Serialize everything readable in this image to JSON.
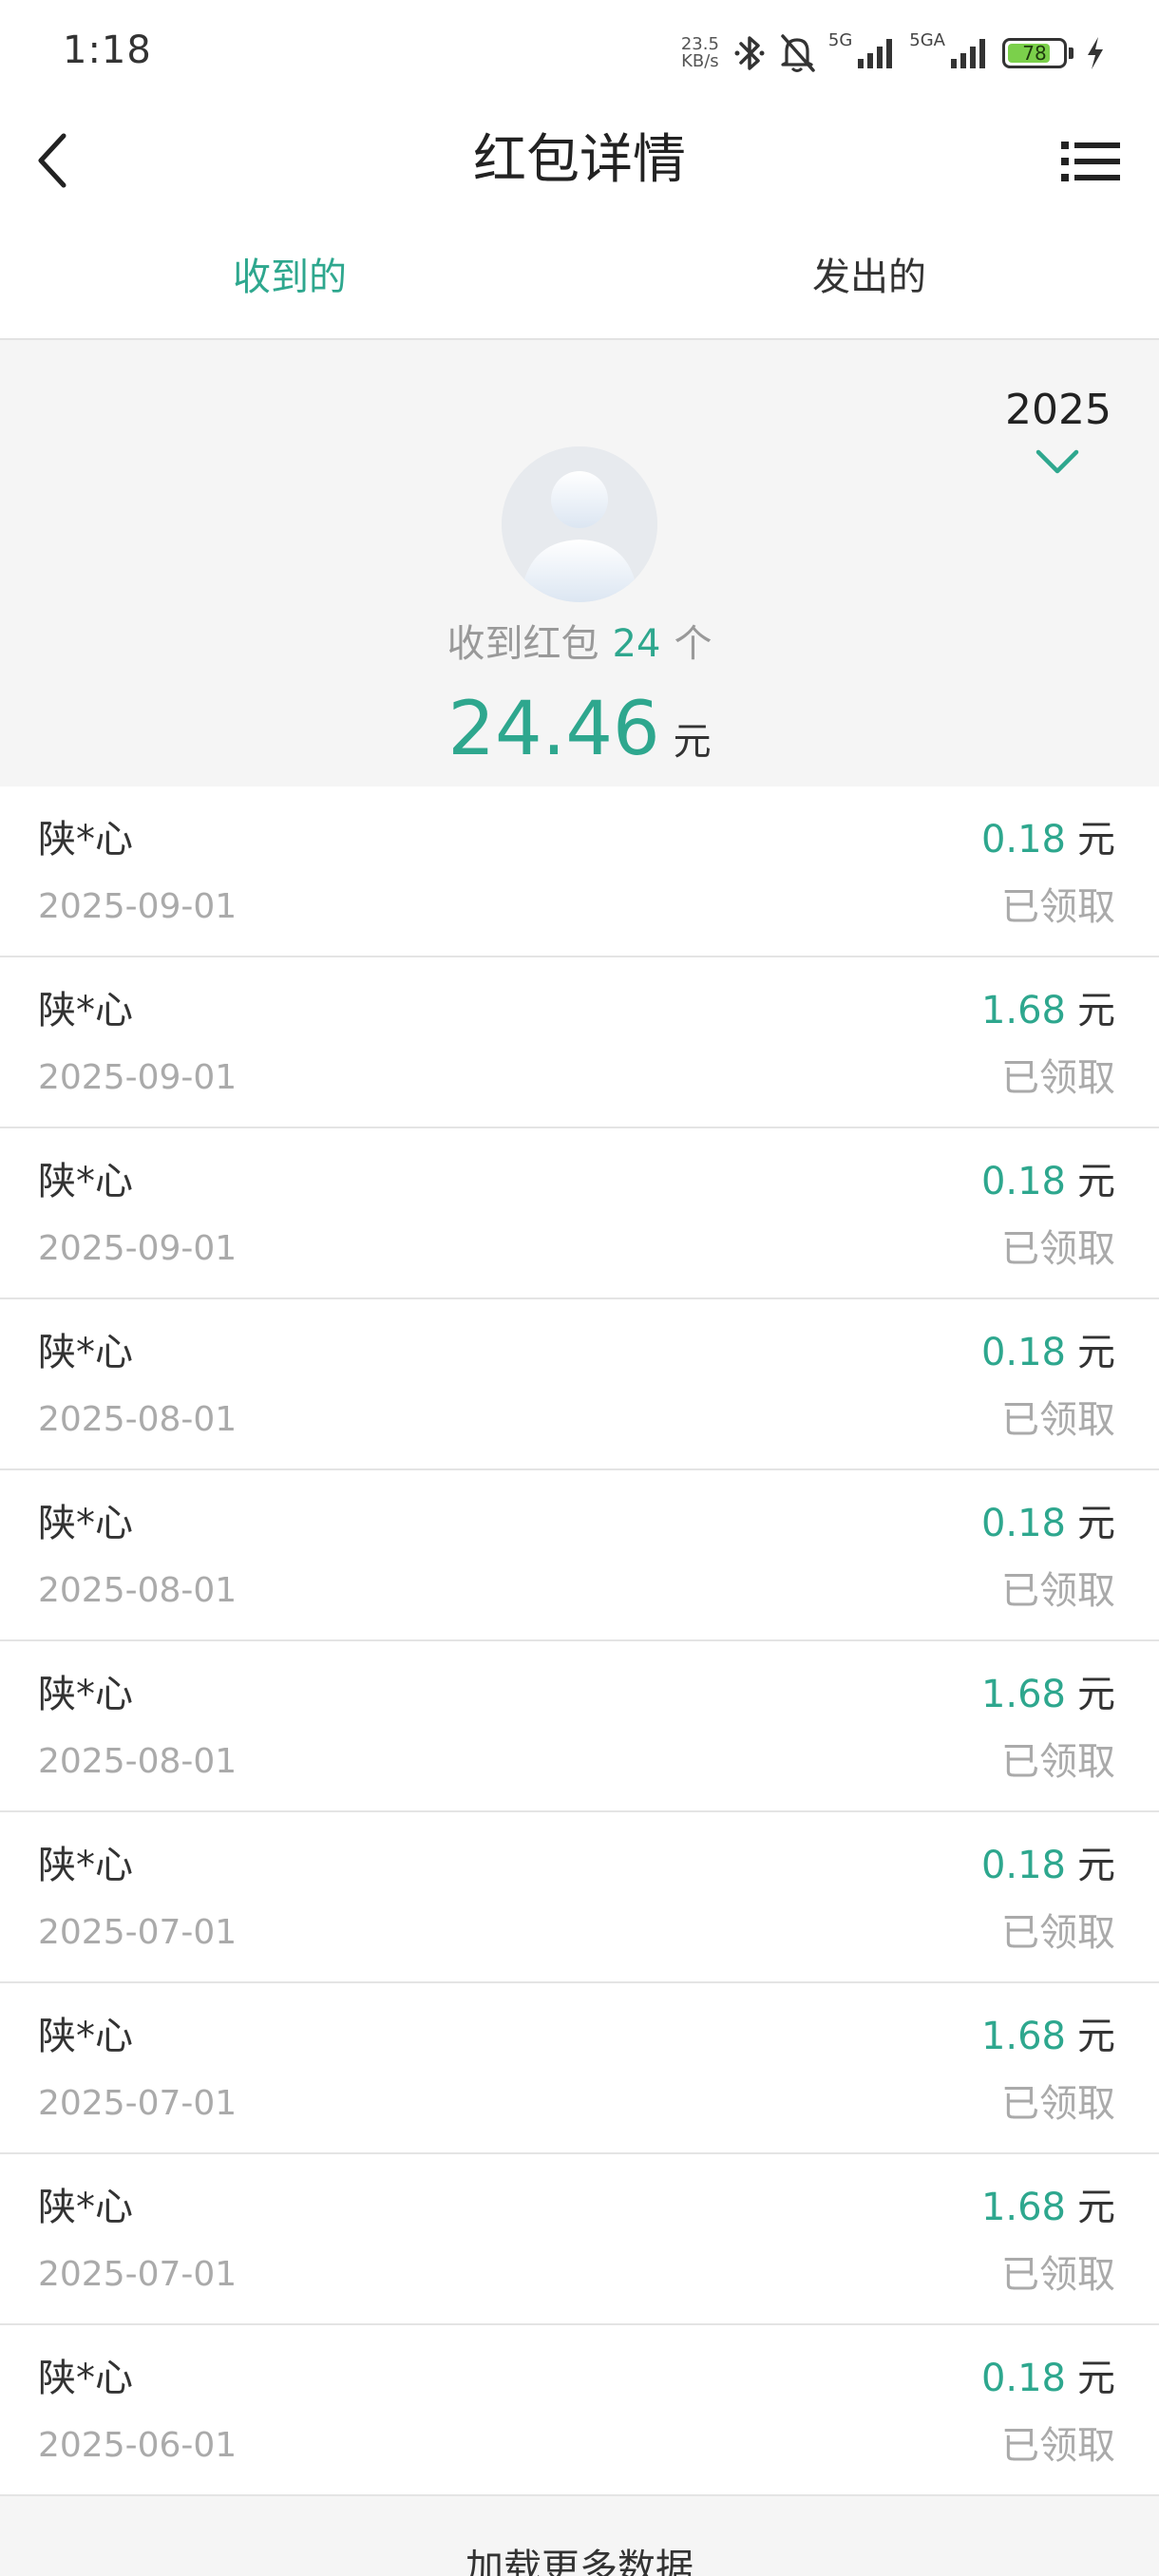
{
  "status_bar": {
    "time": "1:18",
    "net_speed_value": "23.5",
    "net_speed_unit": "KB/s",
    "sim1_label": "5G",
    "sim2_label": "5GA",
    "battery_level": "78",
    "battery_fraction": 0.78,
    "battery_color": "#7bd04b",
    "icons": [
      "bluetooth-icon",
      "mute-bell-icon",
      "signal-icon",
      "battery-icon",
      "charging-icon"
    ]
  },
  "nav": {
    "title": "红包详情",
    "back_icon": "chevron-left-icon",
    "menu_icon": "list-menu-icon"
  },
  "tabs": [
    {
      "label": "收到的",
      "active": true
    },
    {
      "label": "发出的",
      "active": false
    }
  ],
  "summary": {
    "year": "2025",
    "count_prefix": "收到红包",
    "count": "24",
    "count_suffix": "个",
    "total": "24.46",
    "unit": "元"
  },
  "records": [
    {
      "name": "陕*心",
      "date": "2025-09-01",
      "amount": "0.18",
      "unit": "元",
      "status": "已领取"
    },
    {
      "name": "陕*心",
      "date": "2025-09-01",
      "amount": "1.68",
      "unit": "元",
      "status": "已领取"
    },
    {
      "name": "陕*心",
      "date": "2025-09-01",
      "amount": "0.18",
      "unit": "元",
      "status": "已领取"
    },
    {
      "name": "陕*心",
      "date": "2025-08-01",
      "amount": "0.18",
      "unit": "元",
      "status": "已领取"
    },
    {
      "name": "陕*心",
      "date": "2025-08-01",
      "amount": "0.18",
      "unit": "元",
      "status": "已领取"
    },
    {
      "name": "陕*心",
      "date": "2025-08-01",
      "amount": "1.68",
      "unit": "元",
      "status": "已领取"
    },
    {
      "name": "陕*心",
      "date": "2025-07-01",
      "amount": "0.18",
      "unit": "元",
      "status": "已领取"
    },
    {
      "name": "陕*心",
      "date": "2025-07-01",
      "amount": "1.68",
      "unit": "元",
      "status": "已领取"
    },
    {
      "name": "陕*心",
      "date": "2025-07-01",
      "amount": "1.68",
      "unit": "元",
      "status": "已领取"
    },
    {
      "name": "陕*心",
      "date": "2025-06-01",
      "amount": "0.18",
      "unit": "元",
      "status": "已领取"
    }
  ],
  "load_more": {
    "label": "加载更多数据"
  },
  "colors": {
    "accent": "#2ea78e",
    "background_gray": "#f5f5f5",
    "secondary_text": "#aaaaaa"
  }
}
